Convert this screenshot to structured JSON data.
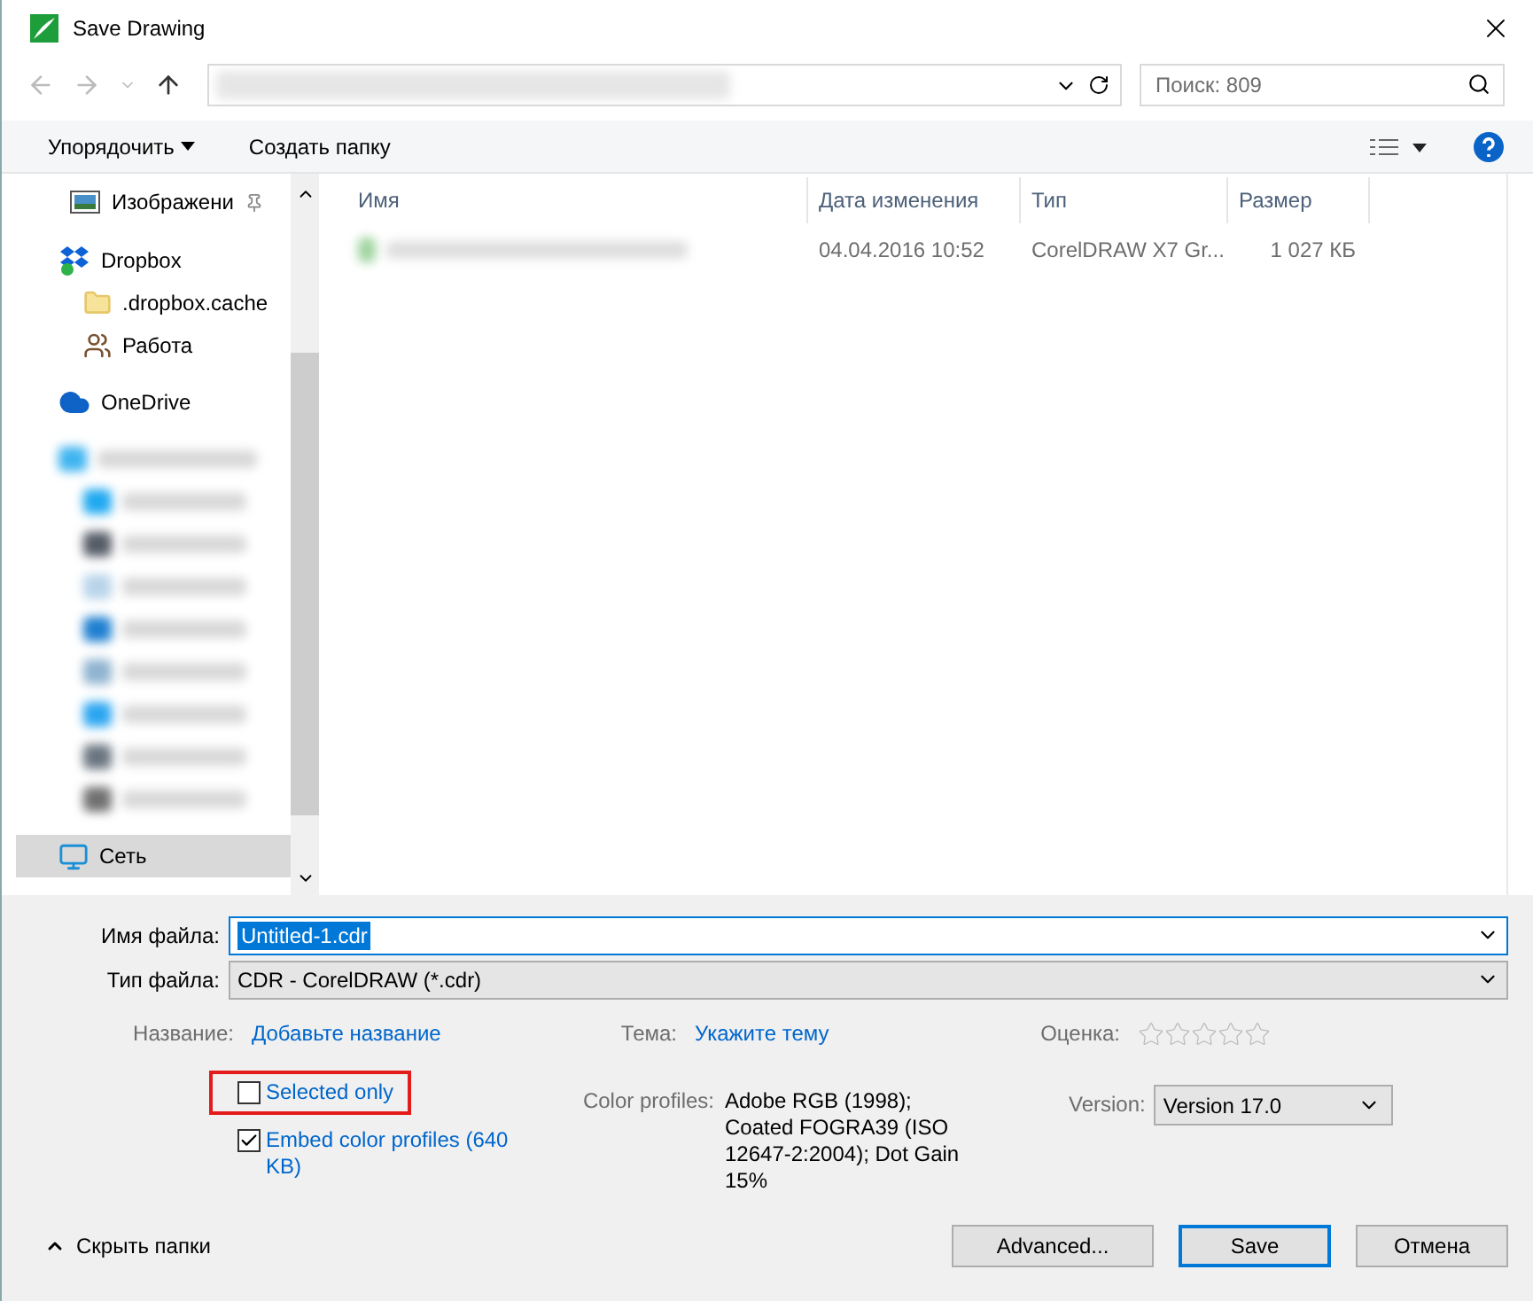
{
  "window": {
    "title": "Save Drawing"
  },
  "navigation": {
    "search": {
      "placeholder": "Поиск: 809"
    }
  },
  "toolbar": {
    "organize": "Упорядочить",
    "new_folder": "Создать папку"
  },
  "sidebar": {
    "items": [
      {
        "label": "Изображени",
        "kind": "pinned",
        "selected": false
      },
      {
        "label": "Dropbox",
        "kind": "dropbox",
        "selected": false,
        "children": [
          {
            "label": ".dropbox.cache",
            "kind": "folder",
            "selected": false
          },
          {
            "label": "Работа",
            "kind": "shared",
            "selected": false
          }
        ]
      },
      {
        "label": "OneDrive",
        "kind": "onedrive",
        "selected": false
      },
      {
        "kind": "blurred",
        "color": "#3fb4f0",
        "selected": false,
        "children": [
          {
            "kind": "blurred",
            "color": "#1fa8f0",
            "selected": false
          },
          {
            "kind": "blurred",
            "color": "#555b66",
            "selected": false
          },
          {
            "kind": "blurred",
            "color": "#b8d4ea",
            "selected": false
          },
          {
            "kind": "blurred",
            "color": "#1e7fd0",
            "selected": false
          },
          {
            "kind": "blurred",
            "color": "#8fb3d0",
            "selected": false
          },
          {
            "kind": "blurred",
            "color": "#2aa5f0",
            "selected": false
          },
          {
            "kind": "blurred",
            "color": "#6a7580",
            "selected": false
          },
          {
            "kind": "blurred",
            "color": "#707070",
            "selected": false
          }
        ]
      },
      {
        "label": "Сеть",
        "kind": "network",
        "selected": true
      }
    ]
  },
  "table": {
    "columns": [
      "Имя",
      "Дата изменения",
      "Тип",
      "Размер"
    ],
    "rows": [
      {
        "kind": "blurred",
        "date": "04.04.2016 10:52",
        "type": "CorelDRAW X7 Gr...",
        "size": "1 027 КБ",
        "selected": false
      }
    ]
  },
  "form": {
    "file_name": {
      "label": "Имя файла:",
      "value": "Untitled-1.cdr"
    },
    "file_type": {
      "label": "Тип файла:",
      "value": "CDR - CorelDRAW (*.cdr)"
    },
    "title": {
      "label": "Название:",
      "link": "Добавьте название"
    },
    "subject": {
      "label": "Тема:",
      "link": "Укажите тему"
    },
    "rating": {
      "label": "Оценка:",
      "stars": 0
    },
    "options": [
      {
        "label": "Selected only",
        "checked": false,
        "highlighted": true
      },
      {
        "label": "Embed color profiles (640 KB)",
        "checked": true,
        "highlighted": false
      }
    ],
    "color_profiles": {
      "label": "Color profiles:",
      "value": "Adobe RGB (1998); Coated FOGRA39 (ISO 12647-2:2004); Dot Gain 15%"
    },
    "version": {
      "label": "Version:",
      "value": "Version 17.0"
    }
  },
  "footer": {
    "hide_folders": "Скрыть папки",
    "buttons": [
      {
        "label": "Advanced...",
        "kind": "normal"
      },
      {
        "label": "Save",
        "kind": "default"
      },
      {
        "label": "Отмена",
        "kind": "normal"
      }
    ]
  }
}
